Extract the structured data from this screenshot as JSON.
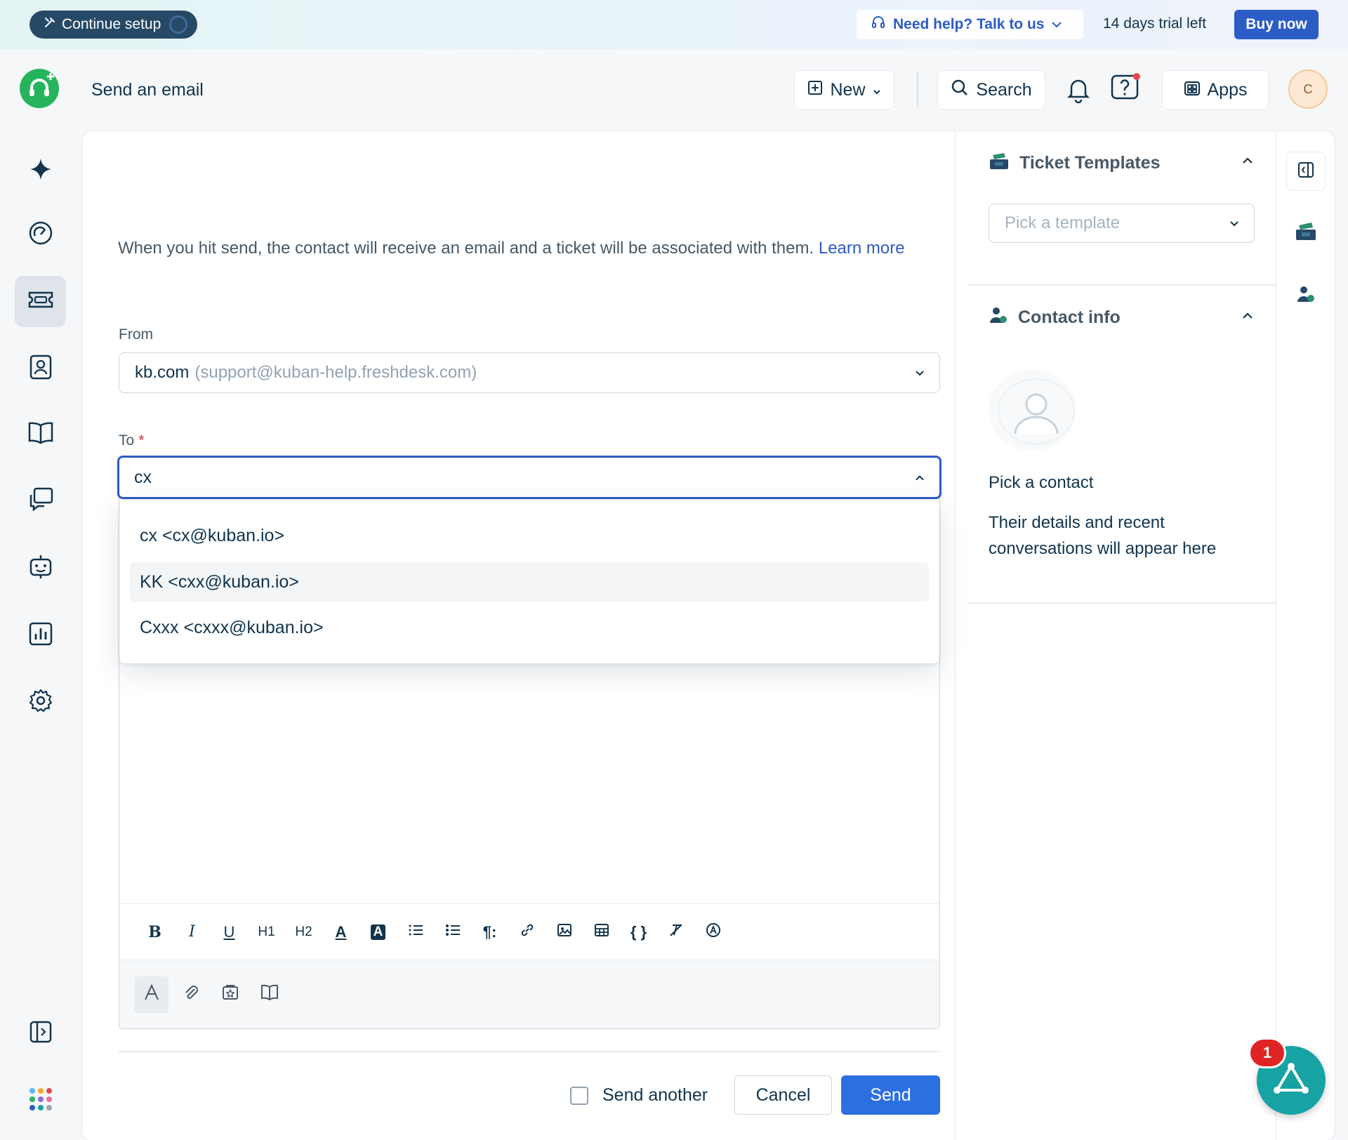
{
  "banner": {
    "setup_label": "Continue setup",
    "help_label": "Need help? Talk to us",
    "trial_text": "14 days trial left",
    "buy_label": "Buy now"
  },
  "header": {
    "title": "Send an email",
    "new_label": "New",
    "search_label": "Search",
    "apps_label": "Apps",
    "avatar_initial": "C"
  },
  "nav": {
    "items": [
      "freddy-ai",
      "dashboard",
      "tickets",
      "contacts",
      "knowledge-base",
      "conversations",
      "bots",
      "analytics",
      "admin-settings"
    ],
    "active": "tickets"
  },
  "form": {
    "intro_text": "When you hit send, the contact will receive an email and a ticket will be associated with them.",
    "intro_link": "Learn more",
    "from_label": "From",
    "from_name": "kb.com",
    "from_address": "(support@kuban-help.freshdesk.com)",
    "to_label": "To",
    "to_required": "*",
    "to_value": "cx",
    "suggestions": [
      "cx <cx@kuban.io>",
      "KK <cxx@kuban.io>",
      "Cxxx <cxxx@kuban.io>"
    ],
    "hovered_suggestion": 1,
    "toolbar": {
      "bold": "B",
      "italic": "I",
      "underline": "U",
      "h1": "H1",
      "h2": "H2",
      "font_color": "A",
      "bg_color": "A",
      "paragraph": "¶:",
      "code": "{ }"
    },
    "send_another_label": "Send another",
    "send_another_checked": false,
    "cancel_label": "Cancel",
    "send_label": "Send"
  },
  "right_panel": {
    "templates_title": "Ticket Templates",
    "template_placeholder": "Pick a template",
    "contact_title": "Contact info",
    "pick_contact": "Pick a contact",
    "details_text": "Their details and recent conversations will appear here"
  },
  "fab": {
    "badge_count": "1"
  },
  "colors": {
    "primary": "#2c5cc5",
    "send_button": "#2c6fe0",
    "brand_green": "#25b45b",
    "fab_teal": "#17a2a4",
    "badge_red": "#e02424"
  }
}
